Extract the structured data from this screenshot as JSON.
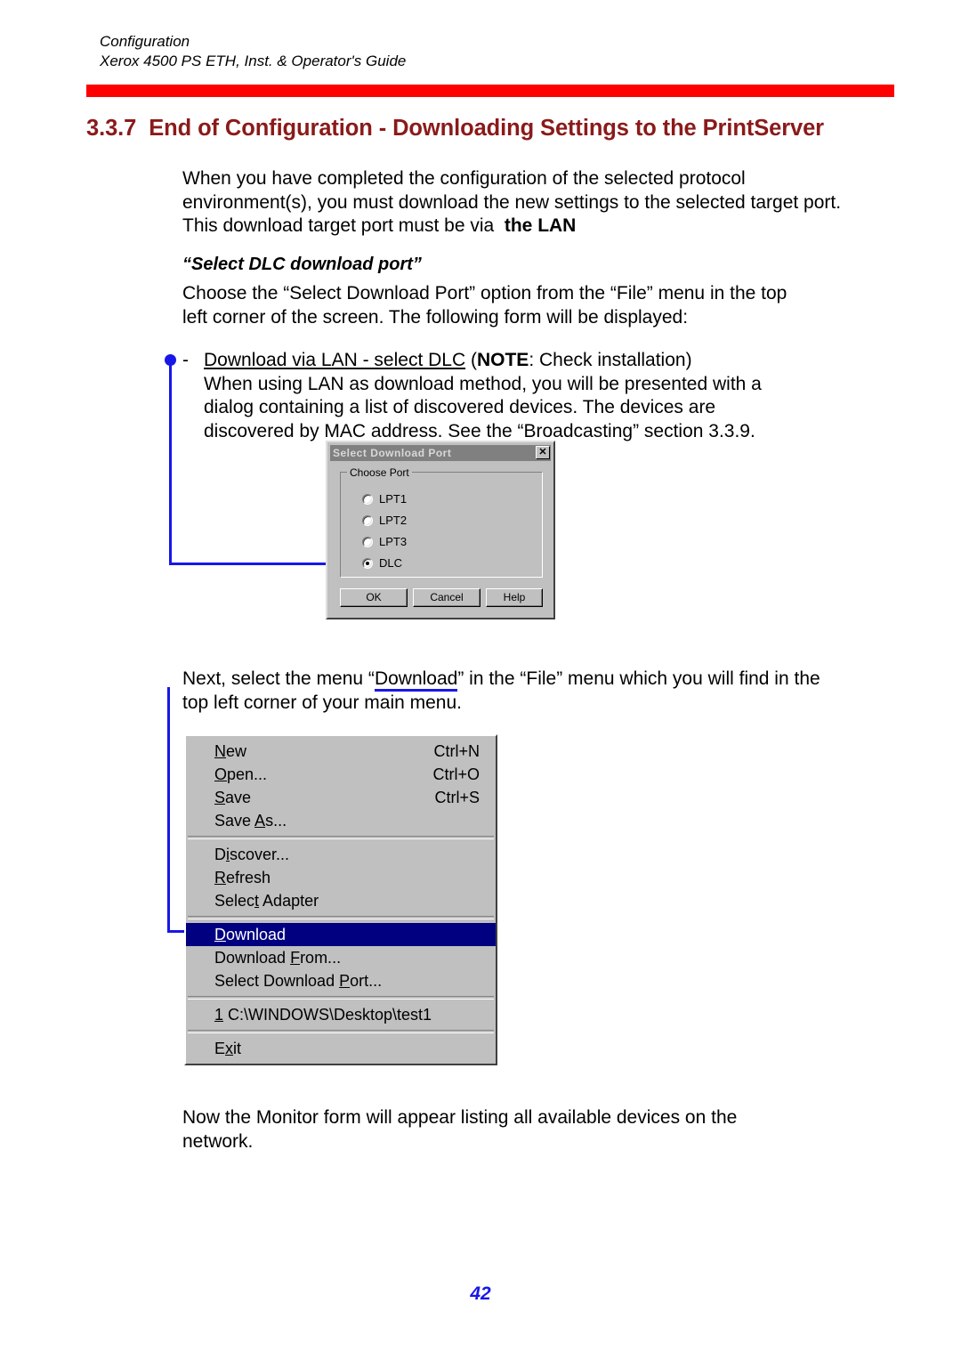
{
  "header": {
    "line1": "Configuration",
    "line2": "Xerox 4500 PS ETH, Inst. & Operator's Guide",
    "rule_color": "#FF0000"
  },
  "heading": {
    "number": "3.3.7",
    "title": "End of Configuration - Downloading Settings to the PrintServer",
    "color": "#8B1A1A"
  },
  "body": {
    "intro_line1": "When you have completed the configuration of the selected protocol",
    "intro_line2": "environment(s), you must download the new settings to the selected target port.",
    "intro_line3_a": "This download target port must be via",
    "intro_line3_b": "the LAN",
    "sub_heading": "“Select DLC download port”",
    "choose_line1": "Choose the “Select Download Port” option from the “File” menu in the top",
    "choose_line2": "left corner of the screen. The following form will be displayed:",
    "bullet_dash": "-",
    "bullet_underlined": "Download via LAN - select DLC",
    "bullet_note_open": "(",
    "bullet_note_label": "NOTE",
    "bullet_note_rest": ": Check installation)",
    "bullet_line2": "When using LAN as download method, you will be presented with a",
    "bullet_line3": "dialog containing a list of discovered devices. The devices are",
    "bullet_line4": "discovered by MAC address. See the “Broadcasting” section 3.3.9.",
    "next_line1_a": "Next, select the menu “",
    "next_line1_underlined": "Download",
    "next_line1_b": "” in the “File” menu which you will find in the",
    "next_line2": "top left corner of your main menu.",
    "now_line1": "Now the Monitor form will appear listing all available devices on the",
    "now_line2": "network."
  },
  "dialog": {
    "title": "Select Download Port",
    "close_label": "✕",
    "groupbox_legend": "Choose Port",
    "radios": [
      {
        "label": "LPT1",
        "selected": false
      },
      {
        "label": "LPT2",
        "selected": false
      },
      {
        "label": "LPT3",
        "selected": false
      },
      {
        "label": "DLC",
        "selected": true
      }
    ],
    "buttons": {
      "ok": "OK",
      "cancel": "Cancel",
      "help": "Help"
    }
  },
  "file_menu": {
    "items": [
      {
        "key": "N",
        "pre": "",
        "post": "ew",
        "accel": "Ctrl+N",
        "selected": false
      },
      {
        "key": "O",
        "pre": "",
        "post": "pen...",
        "accel": "Ctrl+O",
        "selected": false
      },
      {
        "key": "S",
        "pre": "",
        "post": "ave",
        "accel": "Ctrl+S",
        "selected": false
      },
      {
        "key": "A",
        "pre": "Save ",
        "post": "s...",
        "accel": "",
        "selected": false
      },
      {
        "separator": true
      },
      {
        "key": "i",
        "pre": "D",
        "post": "scover...",
        "accel": "",
        "selected": false
      },
      {
        "key": "R",
        "pre": "",
        "post": "efresh",
        "accel": "",
        "selected": false
      },
      {
        "key": "t",
        "pre": "Selec",
        "post": " Adapter",
        "accel": "",
        "selected": false
      },
      {
        "separator": true
      },
      {
        "key": "D",
        "pre": "",
        "post": "ownload",
        "accel": "",
        "selected": true
      },
      {
        "key": "F",
        "pre": "Download ",
        "post": "rom...",
        "accel": "",
        "selected": false
      },
      {
        "key": "P",
        "pre": "Select Download ",
        "post": "ort...",
        "accel": "",
        "selected": false
      },
      {
        "separator": true
      },
      {
        "key": "1",
        "pre": "",
        "post": " C:\\WINDOWS\\Desktop\\test1",
        "accel": "",
        "selected": false
      },
      {
        "separator": true
      },
      {
        "key": "x",
        "pre": "E",
        "post": "it",
        "accel": "",
        "selected": false
      }
    ]
  },
  "annotation": {
    "color": "#1717E8"
  },
  "footer": {
    "page_number": "42"
  }
}
